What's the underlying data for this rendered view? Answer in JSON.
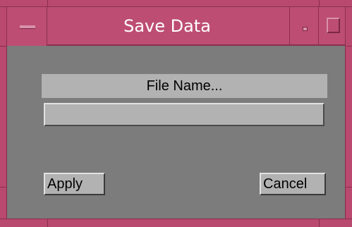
{
  "window": {
    "title": "Save Data",
    "colors": {
      "frame": "#b9496f",
      "frame_dark": "#8a2e50",
      "client_bg": "#7c7c7c",
      "widget_bg": "#b2b2b2",
      "title_text": "#ffffff"
    },
    "controls": {
      "menu_icon": "window-menu-icon",
      "minimize_icon": "minimize-icon",
      "maximize_icon": "maximize-icon"
    }
  },
  "form": {
    "label": "File Name...",
    "input_value": "",
    "apply_label": "Apply",
    "cancel_label": "Cancel"
  }
}
